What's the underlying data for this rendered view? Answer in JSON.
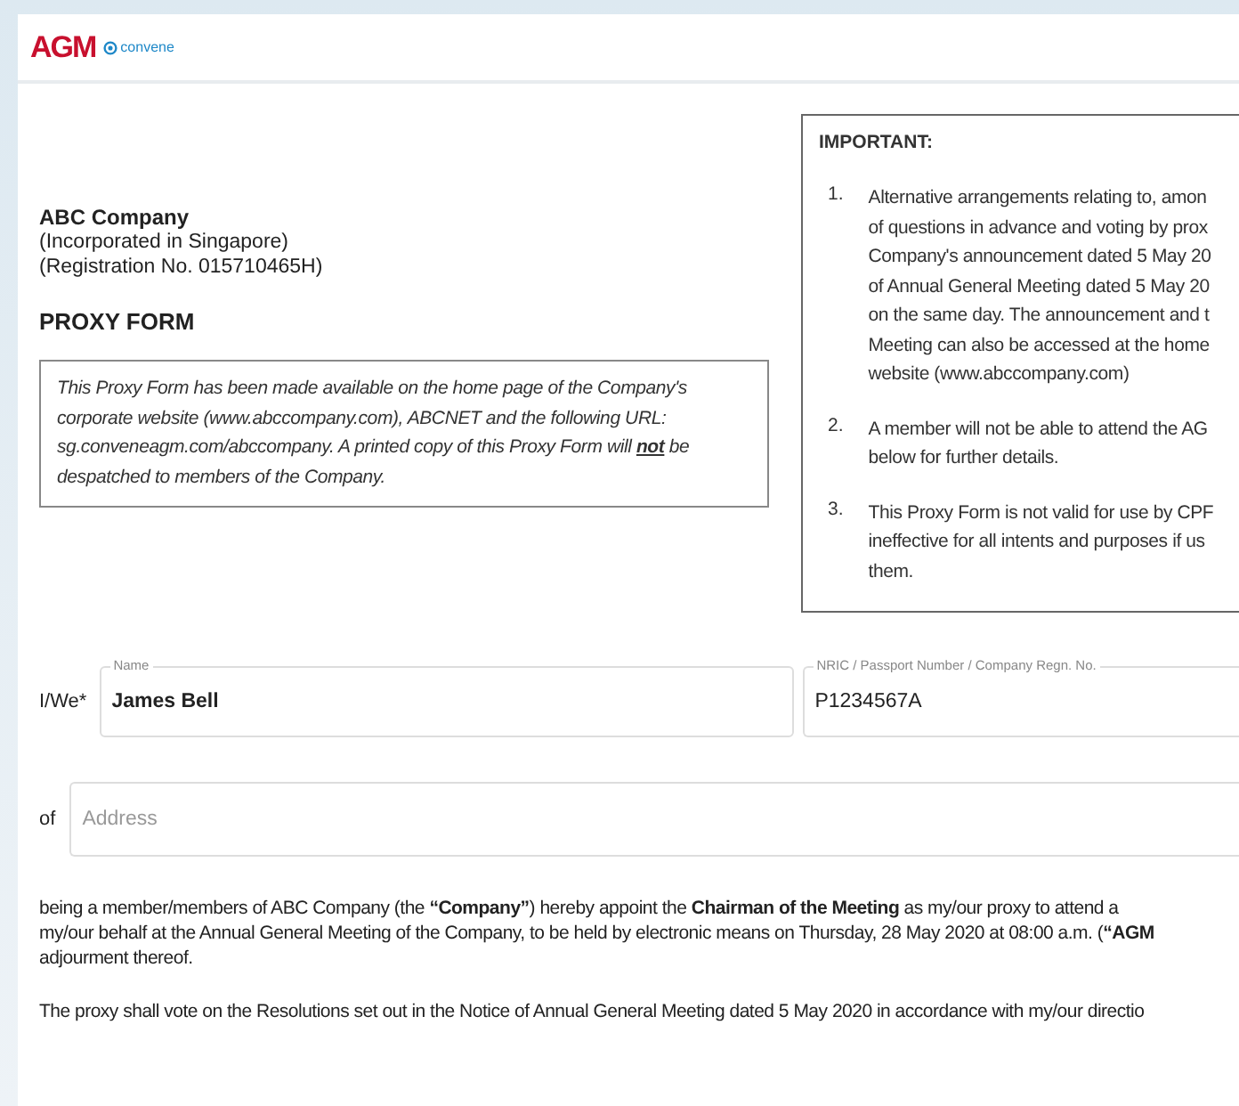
{
  "header": {
    "logo_text": "AGM",
    "brand_text": "convene"
  },
  "company": {
    "name": "ABC Company",
    "lines": [
      "(Incorporated in Singapore)",
      "(Registration No. 015710465H)"
    ]
  },
  "form_title": "PROXY FORM",
  "notice_lines": [
    "This Proxy Form has been made available on the home page of the Company's",
    "corporate website (www.abccompany.com), ABCNET and the following URL:",
    "sg.conveneagm.com/abccompany. A printed copy of this Proxy Form will **not** be",
    "despatched to members of the Company."
  ],
  "important": {
    "title": "IMPORTANT:",
    "items": [
      {
        "number": "1.",
        "lines": [
          "Alternative arrangements relating to, amon",
          "of questions in advance and voting by prox",
          "Company's announcement dated 5 May 20",
          "of Annual General Meeting dated 5 May 20",
          "on the same day. The announcement and t",
          "Meeting can also be accessed at the home",
          "website (www.abccompany.com)"
        ]
      },
      {
        "number": "2.",
        "lines": [
          "A member will not be able to attend the AG",
          "below for further details."
        ]
      },
      {
        "number": "3.",
        "lines": [
          "This Proxy Form is not valid for use by CPF",
          "ineffective for all intents and purposes if us",
          "them."
        ]
      }
    ]
  },
  "member": {
    "prefix": "I/We*",
    "name_field": {
      "label": "Name",
      "value": "James Bell"
    },
    "id_field": {
      "label": "NRIC / Passport Number / Company Regn. No.",
      "value": "P1234567A"
    }
  },
  "address": {
    "prefix": "of",
    "placeholder": "Address"
  },
  "appointment_lines": [
    "being a member/members of ABC Company (the **“Company”**) hereby appoint the **Chairman of the Meeting** as my/our proxy to attend a",
    "my/our behalf at the Annual General Meeting of the Company, to be held by electronic means on Thursday, 28 May 2020 at 08:00 a.m. (**“AGM**",
    "adjourment thereof."
  ],
  "voting_line": "The proxy shall vote on the Resolutions set out in the Notice of Annual General Meeting dated 5 May 2020 in accordance with my/our directio"
}
